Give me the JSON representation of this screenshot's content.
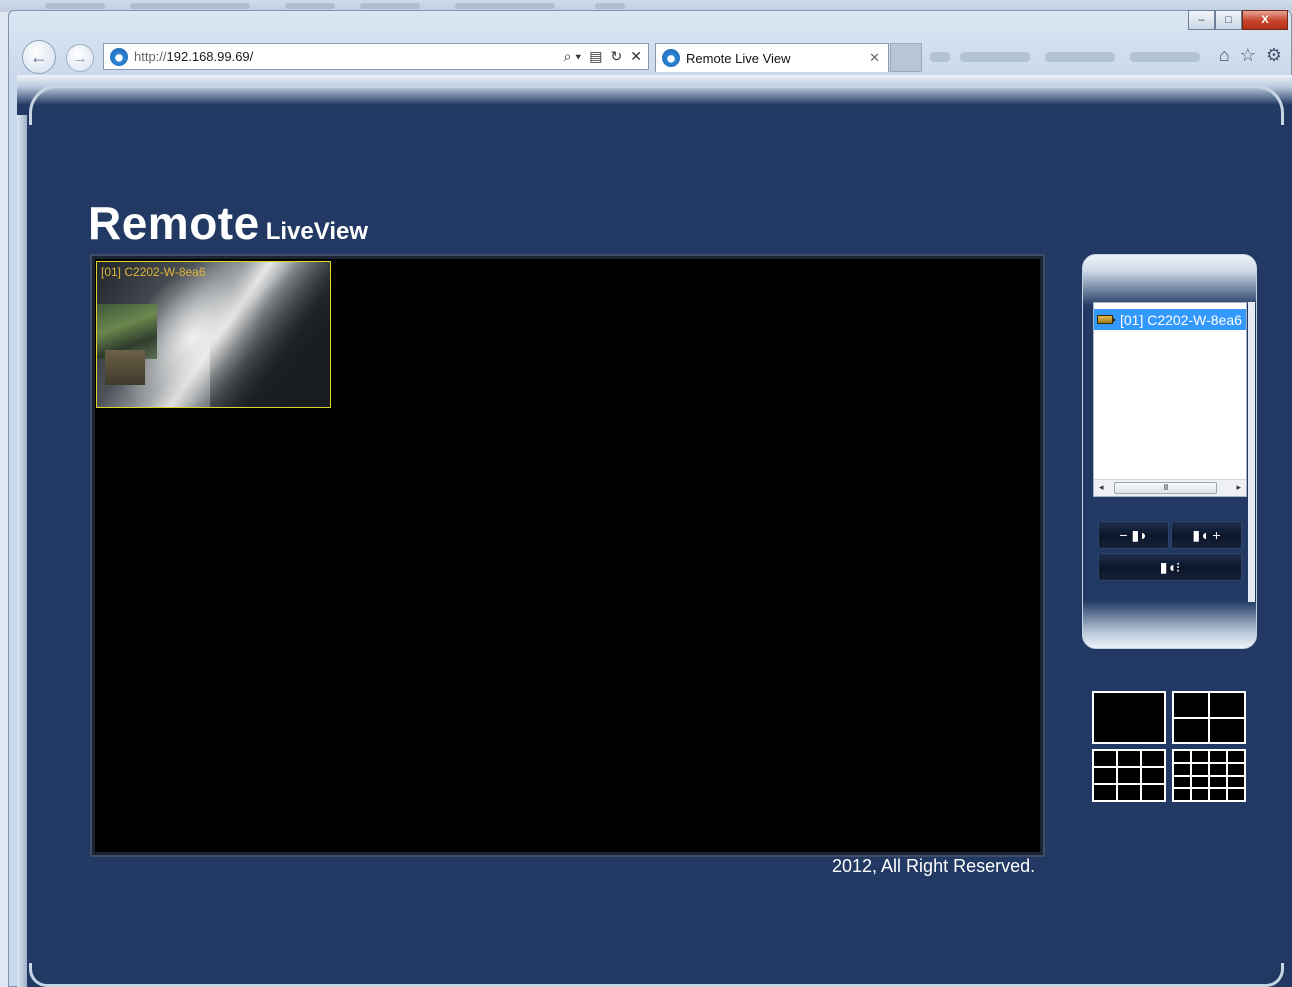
{
  "browser": {
    "address_protocol": "http://",
    "address_host": "192.168.99.69/",
    "tab_title": "Remote Live View",
    "back_glyph": "←",
    "forward_glyph": "→",
    "search_glyph": "⌕ ▾",
    "compat_glyph": "▤",
    "refresh_glyph": "↻",
    "stop_glyph": "✕",
    "tab_close_glyph": "✕",
    "home_glyph": "⌂",
    "favorites_glyph": "☆",
    "tools_glyph": "⚙",
    "window_minimize": "–",
    "window_maximize": "□",
    "window_close": "X"
  },
  "page": {
    "title_main": "Remote",
    "title_sub": "LiveView",
    "copyright": "2012, All Right Reserved."
  },
  "viewer": {
    "channel_label": "[01]  C2202-W-8ea6"
  },
  "camera_list": {
    "items": [
      {
        "label": "[01] C2202-W-8ea6",
        "selected": true,
        "icon": "camera-icon"
      }
    ],
    "scroll_thumb_glyph": "III",
    "scroll_left_glyph": "◂",
    "scroll_right_glyph": "▸"
  },
  "audio_controls": {
    "volume_down": "− ▮◗",
    "volume_up": "▮◖ +",
    "mute": "▮◖⁝"
  },
  "layouts": [
    "1",
    "4",
    "9",
    "16"
  ],
  "colors": {
    "page_background": "#223a63",
    "selection": "#3399ff",
    "channel_label": "#e0b63a",
    "tile_border": "#e0d42a"
  }
}
